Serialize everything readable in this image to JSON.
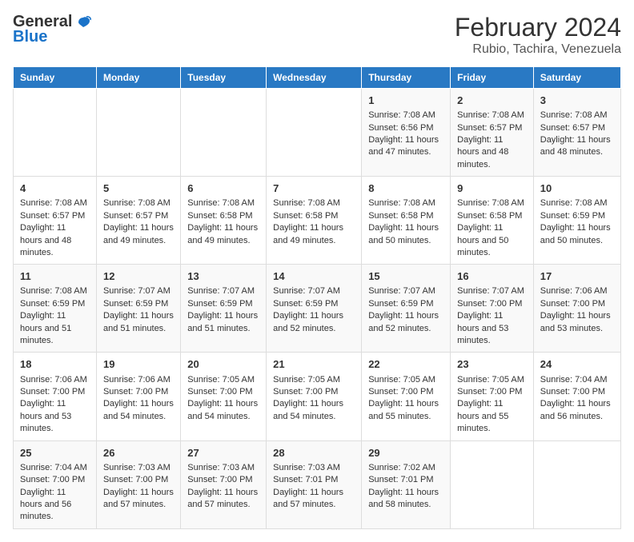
{
  "logo": {
    "general": "General",
    "blue": "Blue"
  },
  "title": "February 2024",
  "subtitle": "Rubio, Tachira, Venezuela",
  "days_header": [
    "Sunday",
    "Monday",
    "Tuesday",
    "Wednesday",
    "Thursday",
    "Friday",
    "Saturday"
  ],
  "weeks": [
    [
      {
        "day": "",
        "data": ""
      },
      {
        "day": "",
        "data": ""
      },
      {
        "day": "",
        "data": ""
      },
      {
        "day": "",
        "data": ""
      },
      {
        "day": "1",
        "data": "Sunrise: 7:08 AM\nSunset: 6:56 PM\nDaylight: 11 hours and 47 minutes."
      },
      {
        "day": "2",
        "data": "Sunrise: 7:08 AM\nSunset: 6:57 PM\nDaylight: 11 hours and 48 minutes."
      },
      {
        "day": "3",
        "data": "Sunrise: 7:08 AM\nSunset: 6:57 PM\nDaylight: 11 hours and 48 minutes."
      }
    ],
    [
      {
        "day": "4",
        "data": "Sunrise: 7:08 AM\nSunset: 6:57 PM\nDaylight: 11 hours and 48 minutes."
      },
      {
        "day": "5",
        "data": "Sunrise: 7:08 AM\nSunset: 6:57 PM\nDaylight: 11 hours and 49 minutes."
      },
      {
        "day": "6",
        "data": "Sunrise: 7:08 AM\nSunset: 6:58 PM\nDaylight: 11 hours and 49 minutes."
      },
      {
        "day": "7",
        "data": "Sunrise: 7:08 AM\nSunset: 6:58 PM\nDaylight: 11 hours and 49 minutes."
      },
      {
        "day": "8",
        "data": "Sunrise: 7:08 AM\nSunset: 6:58 PM\nDaylight: 11 hours and 50 minutes."
      },
      {
        "day": "9",
        "data": "Sunrise: 7:08 AM\nSunset: 6:58 PM\nDaylight: 11 hours and 50 minutes."
      },
      {
        "day": "10",
        "data": "Sunrise: 7:08 AM\nSunset: 6:59 PM\nDaylight: 11 hours and 50 minutes."
      }
    ],
    [
      {
        "day": "11",
        "data": "Sunrise: 7:08 AM\nSunset: 6:59 PM\nDaylight: 11 hours and 51 minutes."
      },
      {
        "day": "12",
        "data": "Sunrise: 7:07 AM\nSunset: 6:59 PM\nDaylight: 11 hours and 51 minutes."
      },
      {
        "day": "13",
        "data": "Sunrise: 7:07 AM\nSunset: 6:59 PM\nDaylight: 11 hours and 51 minutes."
      },
      {
        "day": "14",
        "data": "Sunrise: 7:07 AM\nSunset: 6:59 PM\nDaylight: 11 hours and 52 minutes."
      },
      {
        "day": "15",
        "data": "Sunrise: 7:07 AM\nSunset: 6:59 PM\nDaylight: 11 hours and 52 minutes."
      },
      {
        "day": "16",
        "data": "Sunrise: 7:07 AM\nSunset: 7:00 PM\nDaylight: 11 hours and 53 minutes."
      },
      {
        "day": "17",
        "data": "Sunrise: 7:06 AM\nSunset: 7:00 PM\nDaylight: 11 hours and 53 minutes."
      }
    ],
    [
      {
        "day": "18",
        "data": "Sunrise: 7:06 AM\nSunset: 7:00 PM\nDaylight: 11 hours and 53 minutes."
      },
      {
        "day": "19",
        "data": "Sunrise: 7:06 AM\nSunset: 7:00 PM\nDaylight: 11 hours and 54 minutes."
      },
      {
        "day": "20",
        "data": "Sunrise: 7:05 AM\nSunset: 7:00 PM\nDaylight: 11 hours and 54 minutes."
      },
      {
        "day": "21",
        "data": "Sunrise: 7:05 AM\nSunset: 7:00 PM\nDaylight: 11 hours and 54 minutes."
      },
      {
        "day": "22",
        "data": "Sunrise: 7:05 AM\nSunset: 7:00 PM\nDaylight: 11 hours and 55 minutes."
      },
      {
        "day": "23",
        "data": "Sunrise: 7:05 AM\nSunset: 7:00 PM\nDaylight: 11 hours and 55 minutes."
      },
      {
        "day": "24",
        "data": "Sunrise: 7:04 AM\nSunset: 7:00 PM\nDaylight: 11 hours and 56 minutes."
      }
    ],
    [
      {
        "day": "25",
        "data": "Sunrise: 7:04 AM\nSunset: 7:00 PM\nDaylight: 11 hours and 56 minutes."
      },
      {
        "day": "26",
        "data": "Sunrise: 7:03 AM\nSunset: 7:00 PM\nDaylight: 11 hours and 57 minutes."
      },
      {
        "day": "27",
        "data": "Sunrise: 7:03 AM\nSunset: 7:00 PM\nDaylight: 11 hours and 57 minutes."
      },
      {
        "day": "28",
        "data": "Sunrise: 7:03 AM\nSunset: 7:01 PM\nDaylight: 11 hours and 57 minutes."
      },
      {
        "day": "29",
        "data": "Sunrise: 7:02 AM\nSunset: 7:01 PM\nDaylight: 11 hours and 58 minutes."
      },
      {
        "day": "",
        "data": ""
      },
      {
        "day": "",
        "data": ""
      }
    ]
  ]
}
